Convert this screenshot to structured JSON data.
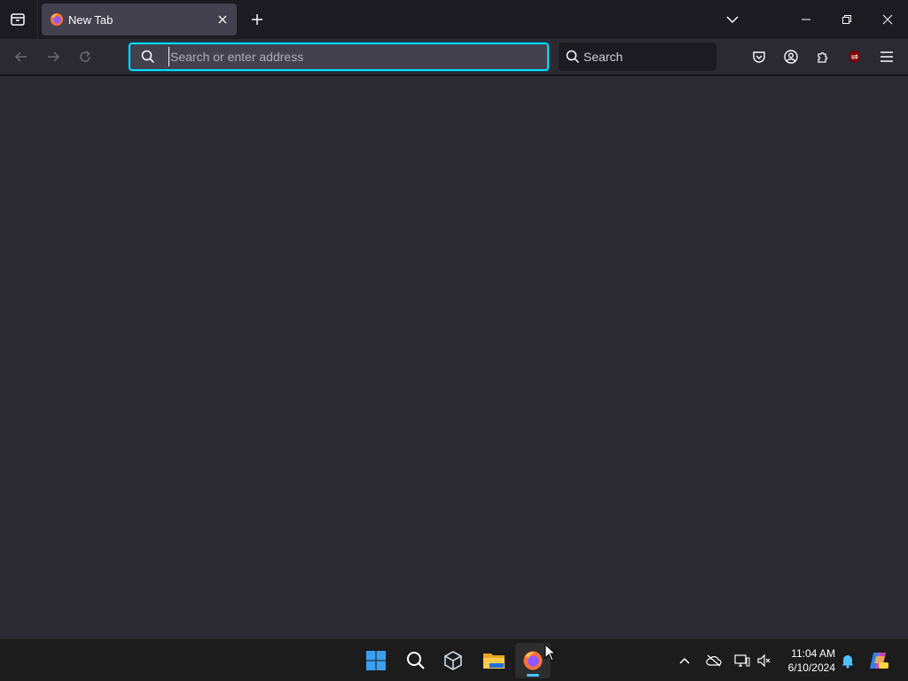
{
  "browser": {
    "tab": {
      "title": "New Tab",
      "favicon": "firefox-icon"
    },
    "urlbar": {
      "placeholder": "Search or enter address",
      "value": ""
    },
    "searchbar": {
      "placeholder": "Search",
      "value": ""
    },
    "colors": {
      "accent": "#00ddff",
      "toolbar": "#2b2a33",
      "frame": "#1c1b22",
      "tab": "#42414d"
    }
  },
  "taskbar": {
    "apps": [
      "start-icon",
      "search-icon",
      "virtualbox-icon",
      "file-explorer-icon",
      "firefox-icon"
    ],
    "clock": {
      "time": "11:04 AM",
      "date": "6/10/2024"
    },
    "tray": [
      "chevron-up-icon",
      "onedrive-offline-icon",
      "network-icon",
      "speaker-muted-icon",
      "notification-bell-icon",
      "copilot-icon"
    ]
  }
}
